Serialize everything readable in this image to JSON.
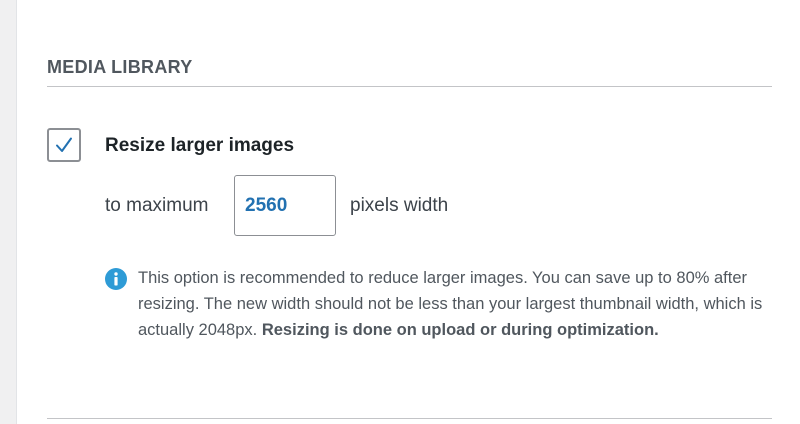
{
  "section": {
    "title": "MEDIA LIBRARY"
  },
  "resize": {
    "checkbox_checked": true,
    "label": "Resize larger images",
    "prefix": "to maximum",
    "width_value": "2560",
    "suffix": "pixels width"
  },
  "info": {
    "icon": "info-icon",
    "text": "This option is recommended to reduce larger images. You can save up to 80% after resizing. The new width should not be less than your largest thumbnail width, which is actually 2048px.",
    "emphasis": "Resizing is done on upload or during optimization."
  },
  "colors": {
    "accent": "#2271b1",
    "info_icon": "#2e9bd6",
    "checkmark": "#2271b1"
  }
}
